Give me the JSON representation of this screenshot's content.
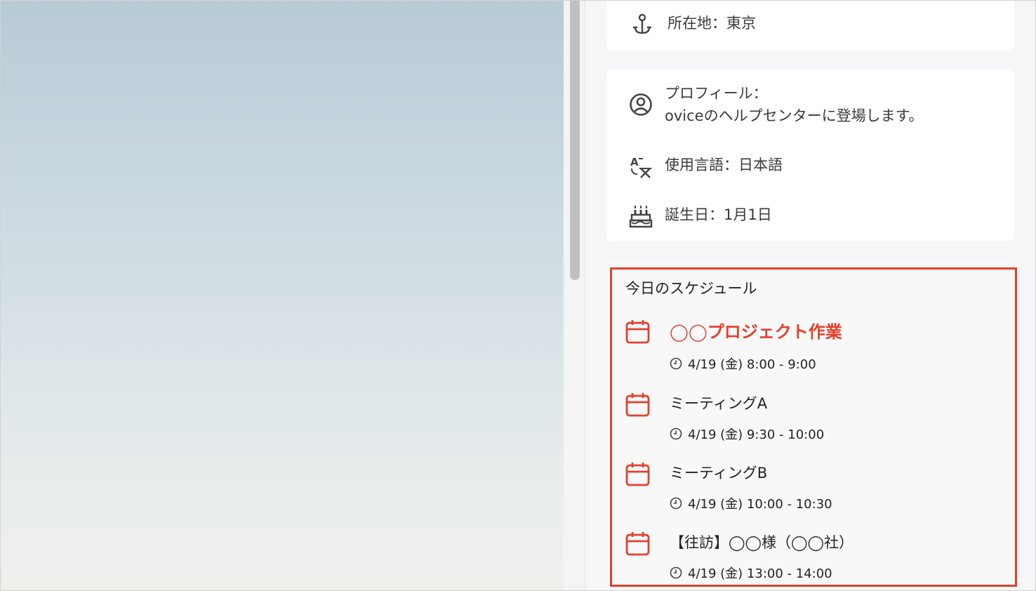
{
  "profile": {
    "location": "所在地：東京",
    "profile_label": "プロフィール：",
    "profile_text": "oviceのヘルプセンターに登場します。",
    "language": "使用言語：日本語",
    "birthday": "誕生日：1月1日"
  },
  "schedule": {
    "title": "今日のスケジュール",
    "events": [
      {
        "title": "◯◯プロジェクト作業",
        "time": "4/19 (金) 8:00 - 9:00"
      },
      {
        "title": "ミーティングA",
        "time": "4/19 (金) 9:30 - 10:00"
      },
      {
        "title": "ミーティングB",
        "time": "4/19 (金) 10:00 - 10:30"
      },
      {
        "title": "【往訪】◯◯様（◯◯社）",
        "time": "4/19 (金) 13:00 - 14:00"
      }
    ]
  },
  "icons": {
    "location": "anchor-icon",
    "profile": "user-circle-icon",
    "language": "translate-icon",
    "birthday": "cake-icon",
    "event": "calendar-icon",
    "time": "clock-icon"
  },
  "colors": {
    "accent": "#e5402c",
    "highlight_border": "#e5402c"
  }
}
